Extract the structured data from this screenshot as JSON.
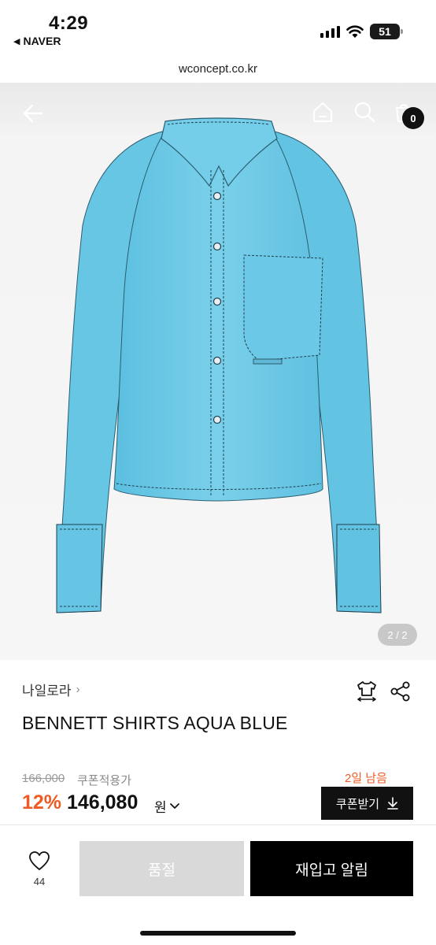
{
  "status_bar": {
    "time": "4:29",
    "back_app": "NAVER",
    "battery": "51"
  },
  "browser": {
    "url": "wconcept.co.kr"
  },
  "gallery": {
    "page_indicator": "2 / 2",
    "cart_count": "0",
    "image_subject": "Aqua blue cropped button-up shirt with dark contrast stitching"
  },
  "product": {
    "brand": "나일로라",
    "name": "BENNETT SHIRTS AQUA BLUE",
    "original_price": "166,000",
    "coupon_price_label": "쿠폰적용가",
    "discount": "12%",
    "price": "146,080",
    "currency": "원",
    "days_left": "2일 남음",
    "coupon_button": "쿠폰받기"
  },
  "bottom_bar": {
    "like_count": "44",
    "soldout_label": "품절",
    "restock_label": "재입고 알림"
  },
  "colors": {
    "accent": "#f05a23",
    "dark": "#111111",
    "shirt": "#6fc8e4",
    "disabled": "#d9d9d9"
  }
}
